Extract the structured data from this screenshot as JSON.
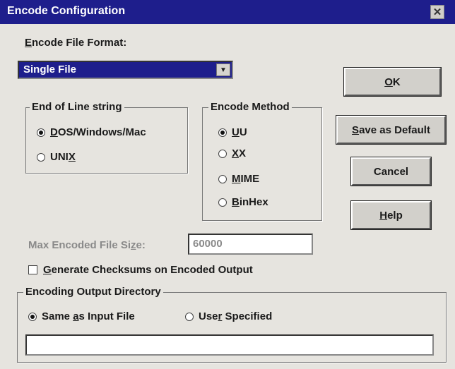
{
  "window": {
    "title": "Encode Configuration",
    "close_glyph": "✕"
  },
  "format": {
    "label_prefix": "E",
    "label_rest": "ncode File Format:",
    "selected": "Single File",
    "arrow": "▼"
  },
  "eol": {
    "legend": "End of Line string",
    "options": [
      {
        "pre": "",
        "u": "D",
        "post": "OS/Windows/Mac",
        "selected": true
      },
      {
        "pre": "UNI",
        "u": "X",
        "post": "",
        "selected": false
      }
    ]
  },
  "method": {
    "legend": "Encode Method",
    "options": [
      {
        "pre": "",
        "u": "U",
        "post": "U",
        "selected": true
      },
      {
        "pre": "",
        "u": "X",
        "post": "X",
        "selected": false
      },
      {
        "pre": "",
        "u": "M",
        "post": "IME",
        "selected": false
      },
      {
        "pre": "",
        "u": "B",
        "post": "inHex",
        "selected": false
      }
    ]
  },
  "buttons": {
    "ok": {
      "pre": "",
      "u": "O",
      "post": "K"
    },
    "save": {
      "pre": "",
      "u": "S",
      "post": "ave as Default"
    },
    "cancel": {
      "label": "Cancel"
    },
    "help": {
      "pre": "",
      "u": "H",
      "post": "elp"
    }
  },
  "max_size": {
    "pre": "Max Encoded File Si",
    "u": "z",
    "post": "e:",
    "value": "60000"
  },
  "checksums": {
    "pre": "",
    "u": "G",
    "post": "enerate Checksums on Encoded Output",
    "checked": false
  },
  "output_dir": {
    "legend": "Encoding Output Directory",
    "same": {
      "pre": "Same ",
      "u": "a",
      "post": "s Input File",
      "selected": true
    },
    "user": {
      "pre": "Use",
      "u": "r",
      "post": " Specified",
      "selected": false
    },
    "path_value": ""
  }
}
